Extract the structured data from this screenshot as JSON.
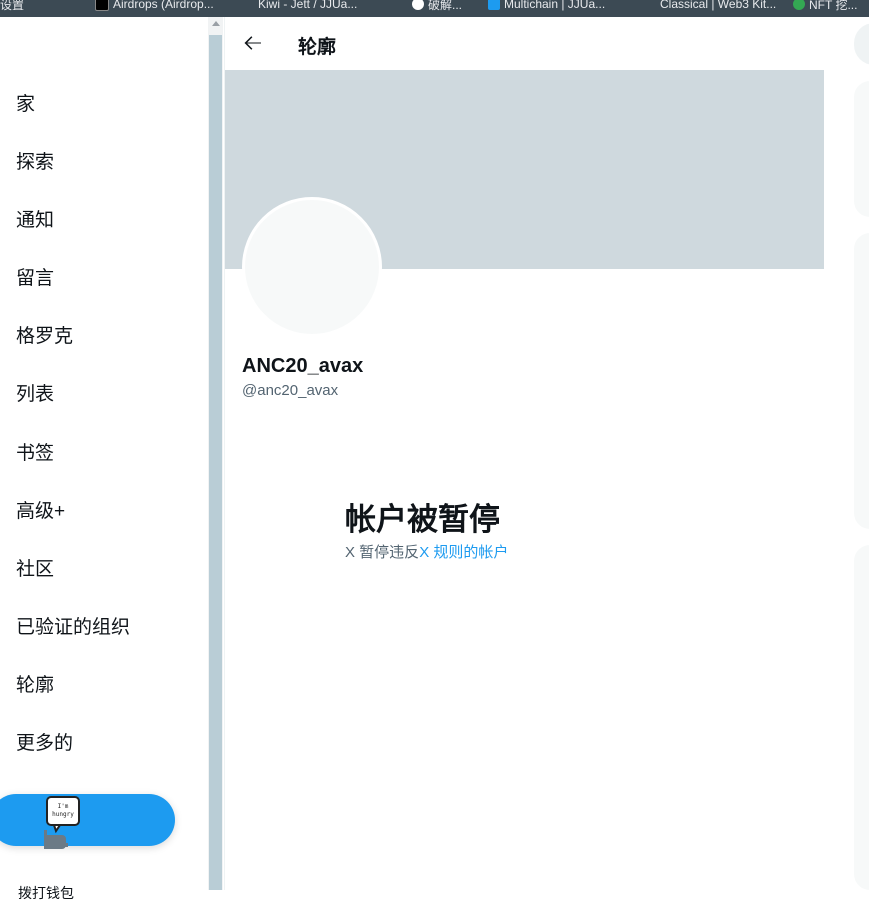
{
  "bookmarks": [
    {
      "label": "设置",
      "color": "#ea4335"
    },
    {
      "label": "Airdrops (Airdrop...",
      "color": "#000000"
    },
    {
      "label": "Kiwi - Jett / JJUa...",
      "color": "#3c4a54"
    },
    {
      "label": "破解...",
      "color": "#ffffff"
    },
    {
      "label": "Multichain | JJUa...",
      "color": "#1d9bf0"
    },
    {
      "label": "Classical | Web3 Kit...",
      "color": "#3c4a54"
    },
    {
      "label": "NFT 挖...",
      "color": "#34a853"
    }
  ],
  "sidebar": {
    "items": [
      {
        "label": "家"
      },
      {
        "label": "探索"
      },
      {
        "label": "通知"
      },
      {
        "label": "留言"
      },
      {
        "label": "格罗克"
      },
      {
        "label": "列表"
      },
      {
        "label": "书签"
      },
      {
        "label": "高级+"
      },
      {
        "label": "社区"
      },
      {
        "label": "已验证的组织"
      },
      {
        "label": "轮廓"
      },
      {
        "label": "更多的"
      }
    ],
    "sticker_text": "I'm hungry",
    "bottom_user_label": "拨打钱包"
  },
  "header": {
    "title": "轮廓",
    "back_icon": "arrow-left-icon"
  },
  "profile": {
    "display_name": "ANC20_avax",
    "handle": "@anc20_avax"
  },
  "suspension": {
    "title": "帐户被暂停",
    "desc_prefix": "X 暂停违反",
    "desc_link": "X 规则的帐户"
  },
  "colors": {
    "accent": "#1d9bf0",
    "banner": "#cfd9de",
    "text": "#0f1419",
    "secondary_text": "#536471"
  }
}
